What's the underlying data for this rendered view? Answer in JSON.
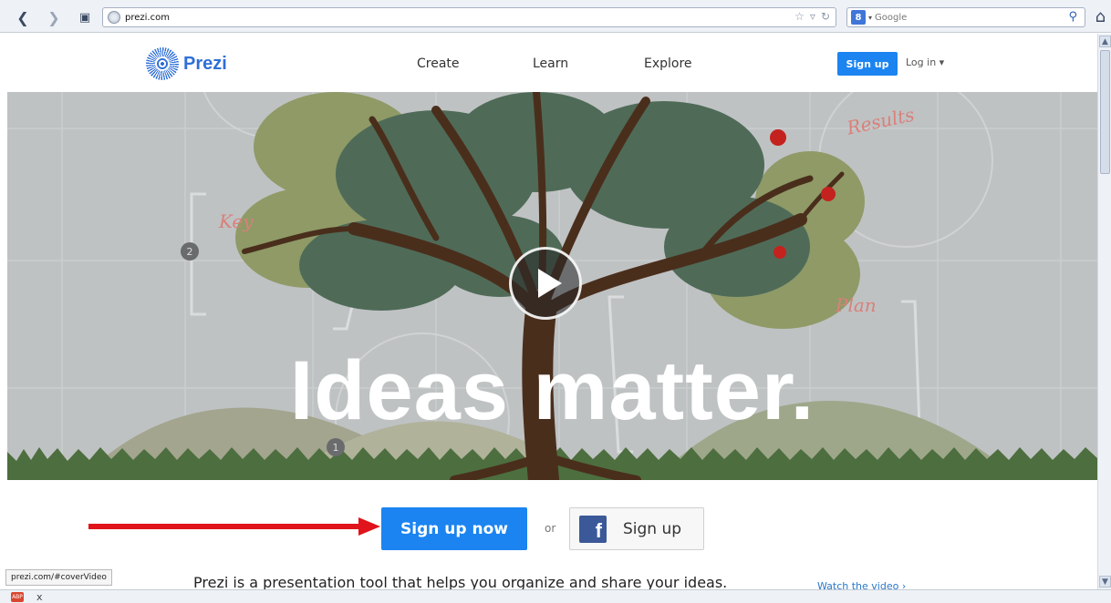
{
  "browser": {
    "url": "prezi.com",
    "search_engine_label": "8",
    "search_placeholder": "Google",
    "back_icon": "arrow-left-icon",
    "forward_icon": "arrow-right-icon",
    "home_icon": "home-icon",
    "status_url": "prezi.com/#coverVideo",
    "status_close": "x"
  },
  "header": {
    "logo_text": "Prezi",
    "nav": [
      {
        "label": "Create"
      },
      {
        "label": "Learn"
      },
      {
        "label": "Explore"
      }
    ],
    "signup_label": "Sign up",
    "login_label": "Log in ▾"
  },
  "hero": {
    "title": "Ideas matter.",
    "labels": {
      "key": "Key",
      "results": "Results",
      "plan": "Plan"
    },
    "badges": [
      "2",
      "1"
    ]
  },
  "cta": {
    "signup_now_label": "Sign up now",
    "or_label": "or",
    "fb_icon_letter": "f",
    "fb_signup_label": "Sign up"
  },
  "footer_text": {
    "tagline": "Prezi is a presentation tool that helps you organize and share your ideas.",
    "watch_video": "Watch the video ›"
  },
  "colors": {
    "accent": "#1b84f0",
    "facebook": "#3b5998",
    "annotation_arrow": "#e0141a"
  }
}
